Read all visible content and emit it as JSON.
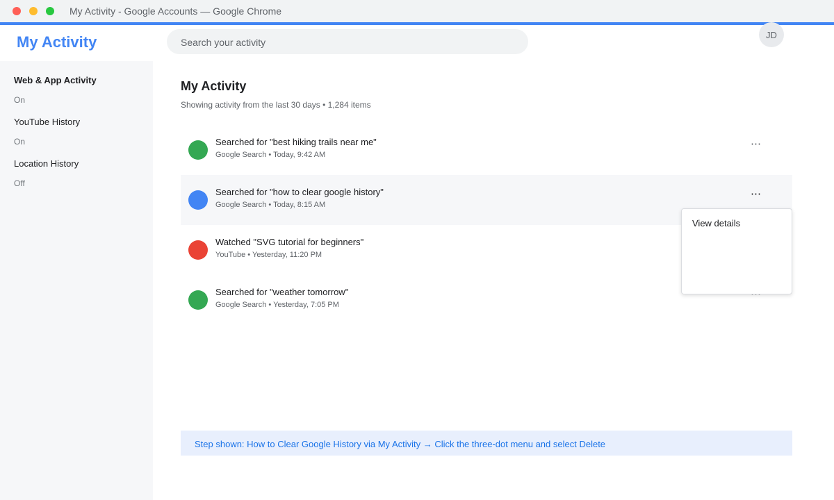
{
  "window": {
    "title": "My Activity - Google Accounts — Google Chrome"
  },
  "colors": {
    "accent": "#4285f4",
    "green": "#34a853",
    "blue": "#4285f4",
    "red": "#ea4335",
    "banner_text": "#1a73e8"
  },
  "header": {
    "brand": "My Activity",
    "search_placeholder": "Search your activity",
    "avatar_initials": "JD"
  },
  "sidebar": {
    "items": [
      {
        "label": "Web & App Activity",
        "state": "On"
      },
      {
        "label": "YouTube History",
        "state": "On"
      },
      {
        "label": "Location History",
        "state": "Off"
      }
    ]
  },
  "main": {
    "title": "My Activity",
    "subtitle": "Showing activity from the last 30 days • 1,284 items",
    "items": [
      {
        "title": "Searched for \"best hiking trails near me\"",
        "meta": "Google Search • Today, 9:42 AM",
        "icon": "google-search-icon",
        "color": "#34a853"
      },
      {
        "title": "Searched for \"how to clear google history\"",
        "meta": "Google Search • Today, 8:15 AM",
        "icon": "google-search-icon",
        "color": "#4285f4"
      },
      {
        "title": "Watched \"SVG tutorial for beginners\"",
        "meta": "YouTube • Yesterday, 11:20 PM",
        "icon": "youtube-icon",
        "color": "#ea4335"
      },
      {
        "title": "Searched for \"weather tomorrow\"",
        "meta": "Google Search • Yesterday, 7:05 PM",
        "icon": "google-search-icon",
        "color": "#34a853"
      }
    ],
    "more_glyph": "⋯",
    "menu": {
      "items": [
        "View details"
      ]
    }
  },
  "banner": {
    "text": "Step shown: How to Clear Google History via My Activity → Click the three-dot menu and select Delete"
  }
}
